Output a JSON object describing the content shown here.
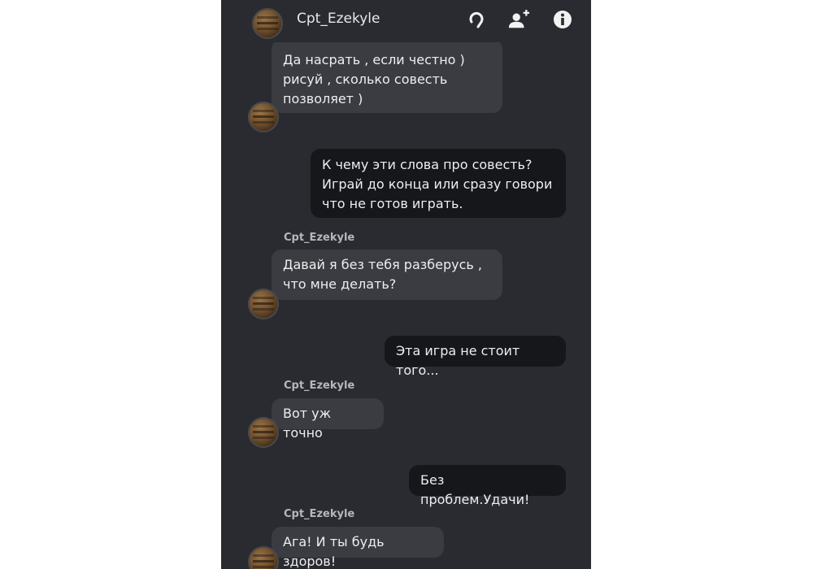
{
  "header": {
    "title": "Cpt_Ezekyle",
    "icons": [
      "headset-icon",
      "add-user-icon",
      "info-icon"
    ]
  },
  "messages": [
    {
      "side": "in",
      "text": "Да насрать , если честно )\nрисуй , сколько совесть\nпозволяет )"
    },
    {
      "side": "out",
      "text": "К чему эти слова про совесть?\nИграй до конца или сразу говори\nчто не готов играть."
    },
    {
      "side": "in",
      "sender": "Cpt_Ezekyle",
      "text": "Давай я без тебя разберусь ,\nчто мне делать?"
    },
    {
      "side": "out",
      "text": "Эта игра не стоит того..."
    },
    {
      "side": "in",
      "sender": "Cpt_Ezekyle",
      "text": "Вот уж точно"
    },
    {
      "side": "out",
      "text": "Без проблем.Удачи!"
    },
    {
      "side": "in",
      "sender": "Cpt_Ezekyle",
      "text": "Ага! И ты будь здоров!"
    }
  ]
}
